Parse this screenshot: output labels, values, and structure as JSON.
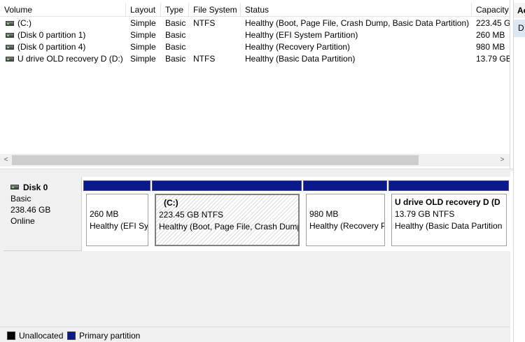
{
  "columns": [
    "Volume",
    "Layout",
    "Type",
    "File System",
    "Status",
    "Capacity"
  ],
  "volumes": [
    {
      "name": "(C:)",
      "layout": "Simple",
      "type": "Basic",
      "fs": "NTFS",
      "status": "Healthy (Boot, Page File, Crash Dump, Basic Data Partition)",
      "capacity": "223.45 G"
    },
    {
      "name": "(Disk 0 partition 1)",
      "layout": "Simple",
      "type": "Basic",
      "fs": "",
      "status": "Healthy (EFI System Partition)",
      "capacity": "260 MB"
    },
    {
      "name": "(Disk 0 partition 4)",
      "layout": "Simple",
      "type": "Basic",
      "fs": "",
      "status": "Healthy (Recovery Partition)",
      "capacity": "980 MB"
    },
    {
      "name": "U drive OLD recovery D (D:)",
      "layout": "Simple",
      "type": "Basic",
      "fs": "NTFS",
      "status": "Healthy (Basic Data Partition)",
      "capacity": "13.79 GB"
    }
  ],
  "scroll": {
    "left_arrow": "<",
    "right_arrow": ">"
  },
  "actions": {
    "header": "Ac",
    "item": "D"
  },
  "disk": {
    "name": "Disk 0",
    "type": "Basic",
    "size": "238.46 GB",
    "state": "Online",
    "partitions": [
      {
        "title": "",
        "size": "260 MB",
        "status": "Healthy (EFI Sy"
      },
      {
        "title": "(C:)",
        "size": "223.45 GB NTFS",
        "status": "Healthy (Boot, Page File, Crash Dump"
      },
      {
        "title": "",
        "size": "980 MB",
        "status": "Healthy (Recovery P"
      },
      {
        "title": "U drive OLD recovery D  (D",
        "size": "13.79 GB NTFS",
        "status": "Healthy (Basic Data Partition"
      }
    ]
  },
  "legend": [
    {
      "label": "Unallocated",
      "color": "#000000"
    },
    {
      "label": "Primary partition",
      "color": "#0a1a8c"
    }
  ],
  "colors": {
    "primary": "#0a1a8c",
    "unallocated": "#000000",
    "pane_bg": "#f0f0f0"
  }
}
